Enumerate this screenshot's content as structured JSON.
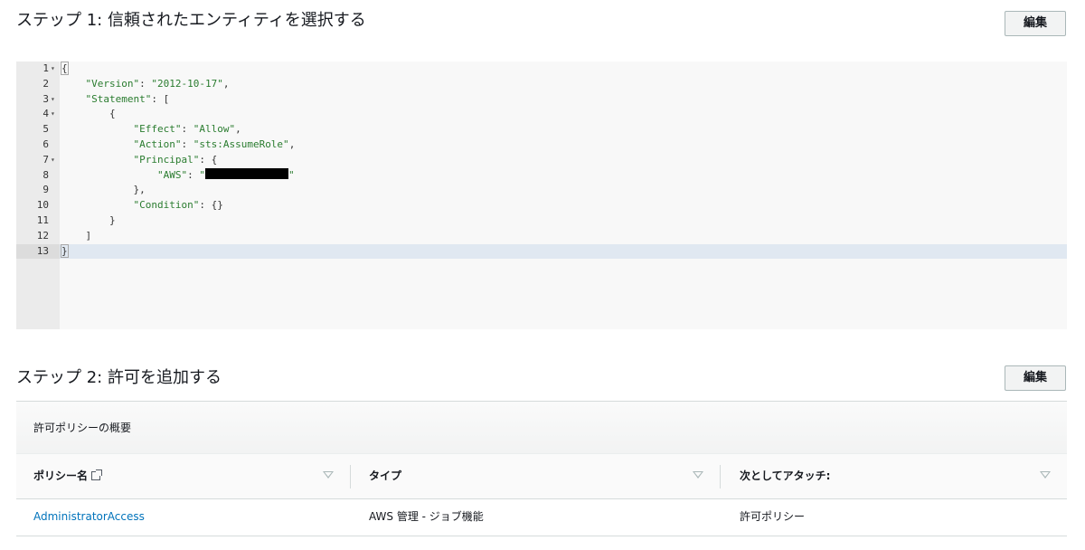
{
  "step1": {
    "title": "ステップ 1: 信頼されたエンティティを選択する",
    "edit_label": "編集"
  },
  "editor": {
    "lines": [
      {
        "n": "1",
        "fold": true
      },
      {
        "n": "2",
        "fold": false
      },
      {
        "n": "3",
        "fold": true
      },
      {
        "n": "4",
        "fold": true
      },
      {
        "n": "5",
        "fold": false
      },
      {
        "n": "6",
        "fold": false
      },
      {
        "n": "7",
        "fold": true
      },
      {
        "n": "8",
        "fold": false
      },
      {
        "n": "9",
        "fold": false
      },
      {
        "n": "10",
        "fold": false
      },
      {
        "n": "11",
        "fold": false
      },
      {
        "n": "12",
        "fold": false
      },
      {
        "n": "13",
        "fold": false
      }
    ],
    "code": {
      "version_key": "\"Version\"",
      "version_val": "\"2012-10-17\"",
      "statement_key": "\"Statement\"",
      "effect_key": "\"Effect\"",
      "effect_val": "\"Allow\"",
      "action_key": "\"Action\"",
      "action_val": "\"sts:AssumeRole\"",
      "principal_key": "\"Principal\"",
      "aws_key": "\"AWS\"",
      "condition_key": "\"Condition\""
    },
    "active_line": "13"
  },
  "step2": {
    "title": "ステップ 2: 許可を追加する",
    "edit_label": "編集"
  },
  "summary": {
    "header": "許可ポリシーの概要",
    "columns": [
      "ポリシー名",
      "タイプ",
      "次としてアタッチ:"
    ],
    "rows": [
      [
        "AdministratorAccess",
        "AWS 管理 - ジョブ機能",
        "許可ポリシー"
      ]
    ]
  }
}
